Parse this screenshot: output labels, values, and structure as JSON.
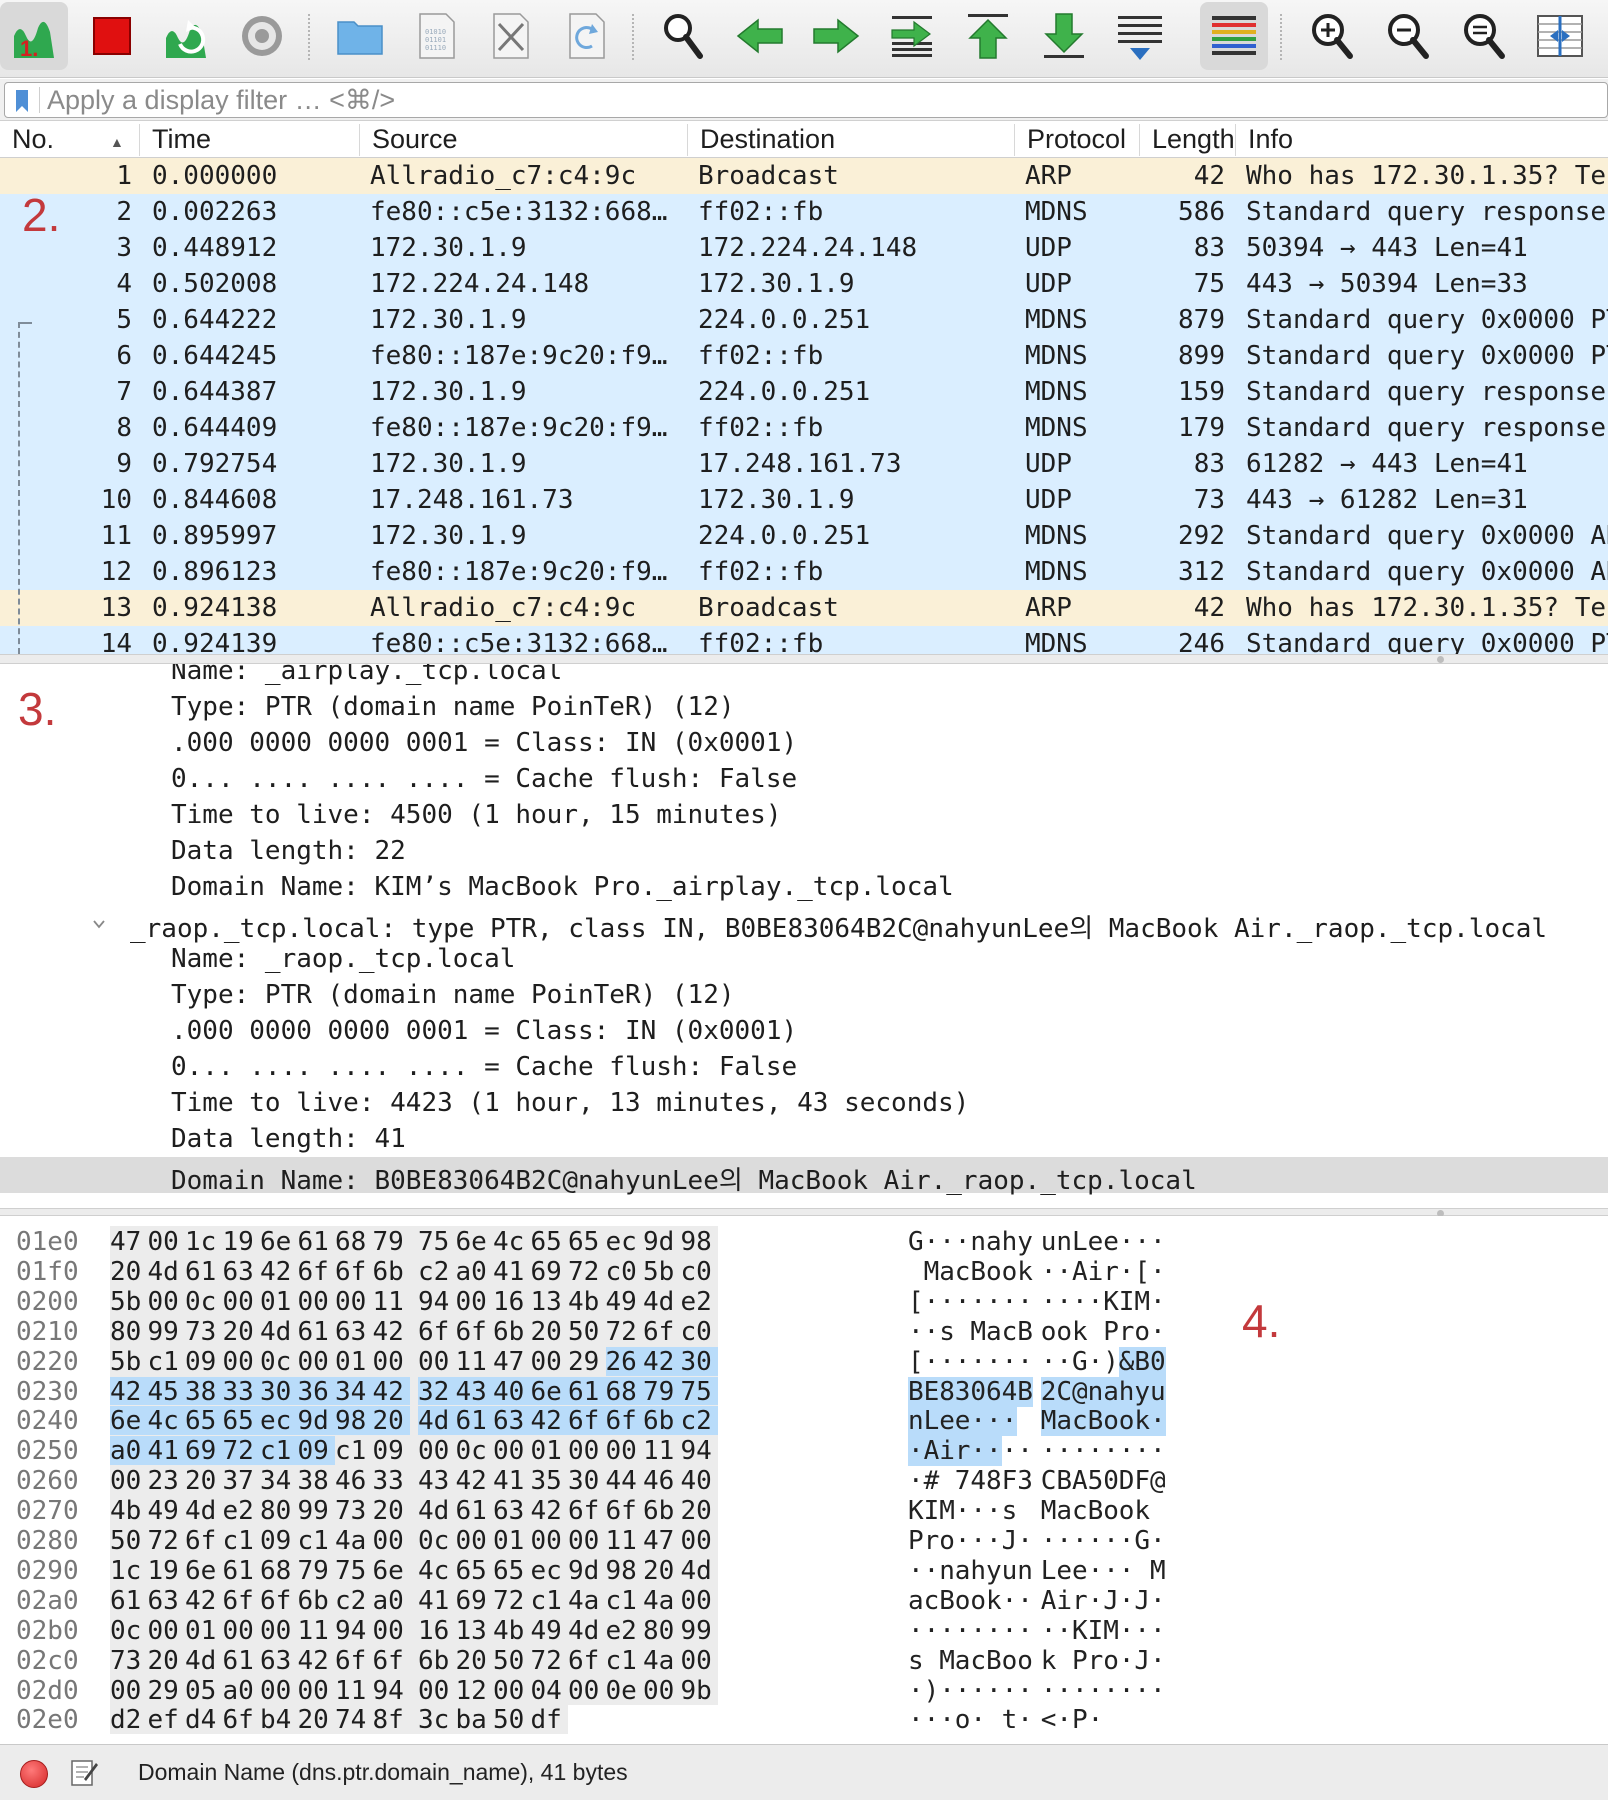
{
  "filter": {
    "placeholder": "Apply a display filter … <⌘/>"
  },
  "columns": [
    "No.",
    "Time",
    "Source",
    "Destination",
    "Protocol",
    "Length",
    "Info"
  ],
  "packets": [
    {
      "no": "1",
      "time": "0.000000",
      "src": "Allradio_c7:c4:9c",
      "dst": "Broadcast",
      "proto": "ARP",
      "len": "42",
      "info": "Who has 172.30.1.35? Te",
      "kind": "arp"
    },
    {
      "no": "2",
      "time": "0.002263",
      "src": "fe80::c5e:3132:668…",
      "dst": "ff02::fb",
      "proto": "MDNS",
      "len": "586",
      "info": "Standard query response",
      "kind": "udp"
    },
    {
      "no": "3",
      "time": "0.448912",
      "src": "172.30.1.9",
      "dst": "172.224.24.148",
      "proto": "UDP",
      "len": "83",
      "info": "50394 → 443 Len=41",
      "kind": "udp"
    },
    {
      "no": "4",
      "time": "0.502008",
      "src": "172.224.24.148",
      "dst": "172.30.1.9",
      "proto": "UDP",
      "len": "75",
      "info": "443 → 50394 Len=33",
      "kind": "udp"
    },
    {
      "no": "5",
      "time": "0.644222",
      "src": "172.30.1.9",
      "dst": "224.0.0.251",
      "proto": "MDNS",
      "len": "879",
      "info": "Standard query 0x0000 PT",
      "kind": "udp"
    },
    {
      "no": "6",
      "time": "0.644245",
      "src": "fe80::187e:9c20:f9…",
      "dst": "ff02::fb",
      "proto": "MDNS",
      "len": "899",
      "info": "Standard query 0x0000 PT",
      "kind": "udp"
    },
    {
      "no": "7",
      "time": "0.644387",
      "src": "172.30.1.9",
      "dst": "224.0.0.251",
      "proto": "MDNS",
      "len": "159",
      "info": "Standard query response",
      "kind": "udp"
    },
    {
      "no": "8",
      "time": "0.644409",
      "src": "fe80::187e:9c20:f9…",
      "dst": "ff02::fb",
      "proto": "MDNS",
      "len": "179",
      "info": "Standard query response",
      "kind": "udp"
    },
    {
      "no": "9",
      "time": "0.792754",
      "src": "172.30.1.9",
      "dst": "17.248.161.73",
      "proto": "UDP",
      "len": "83",
      "info": "61282 → 443 Len=41",
      "kind": "udp"
    },
    {
      "no": "10",
      "time": "0.844608",
      "src": "17.248.161.73",
      "dst": "172.30.1.9",
      "proto": "UDP",
      "len": "73",
      "info": "443 → 61282 Len=31",
      "kind": "udp"
    },
    {
      "no": "11",
      "time": "0.895997",
      "src": "172.30.1.9",
      "dst": "224.0.0.251",
      "proto": "MDNS",
      "len": "292",
      "info": "Standard query 0x0000 AN",
      "kind": "udp"
    },
    {
      "no": "12",
      "time": "0.896123",
      "src": "fe80::187e:9c20:f9…",
      "dst": "ff02::fb",
      "proto": "MDNS",
      "len": "312",
      "info": "Standard query 0x0000 AN",
      "kind": "udp"
    },
    {
      "no": "13",
      "time": "0.924138",
      "src": "Allradio_c7:c4:9c",
      "dst": "Broadcast",
      "proto": "ARP",
      "len": "42",
      "info": "Who has 172.30.1.35? Te",
      "kind": "arp"
    },
    {
      "no": "14",
      "time": "0.924139",
      "src": "fe80::c5e:3132:668…",
      "dst": "ff02::fb",
      "proto": "MDNS",
      "len": "246",
      "info": "Standard query 0x0000 PT",
      "kind": "udp"
    }
  ],
  "annotations": {
    "a2": "2.",
    "a3": "3.",
    "a4": "4."
  },
  "details": [
    {
      "text": "Name: _airplay._tcp.local",
      "indent": 2
    },
    {
      "text": "Type: PTR (domain name PoinTeR) (12)",
      "indent": 2
    },
    {
      "text": ".000 0000 0000 0001 = Class: IN (0x0001)",
      "indent": 2
    },
    {
      "text": "0... .... .... .... = Cache flush: False",
      "indent": 2
    },
    {
      "text": "Time to live: 4500 (1 hour, 15 minutes)",
      "indent": 2
    },
    {
      "text": "Data length: 22",
      "indent": 2
    },
    {
      "text": "Domain Name: KIM’s MacBook Pro._airplay._tcp.local",
      "indent": 2
    },
    {
      "text": "_raop._tcp.local: type PTR, class IN, B0BE83064B2C@nahyunLee의 MacBook Air._raop._tcp.local",
      "indent": 1,
      "expanded": true
    },
    {
      "text": "Name: _raop._tcp.local",
      "indent": 2
    },
    {
      "text": "Type: PTR (domain name PoinTeR) (12)",
      "indent": 2
    },
    {
      "text": ".000 0000 0000 0001 = Class: IN (0x0001)",
      "indent": 2
    },
    {
      "text": "0... .... .... .... = Cache flush: False",
      "indent": 2
    },
    {
      "text": "Time to live: 4423 (1 hour, 13 minutes, 43 seconds)",
      "indent": 2
    },
    {
      "text": "Data length: 41",
      "indent": 2
    },
    {
      "text": "Domain Name: B0BE83064B2C@nahyunLee의 MacBook Air._raop._tcp.local",
      "indent": 2,
      "selected": true
    }
  ],
  "hex": [
    {
      "off": "01e0",
      "bytes": "47 00 1c 19 6e 61 68 79 75 6e 4c 65 65 ec 9d 98",
      "ascii": "G···nahyunLee···",
      "hl": []
    },
    {
      "off": "01f0",
      "bytes": "20 4d 61 63 42 6f 6f 6b c2 a0 41 69 72 c0 5b c0",
      "ascii": " MacBook··Air·[·",
      "hl": []
    },
    {
      "off": "0200",
      "bytes": "5b 00 0c 00 01 00 00 11 94 00 16 13 4b 49 4d e2",
      "ascii": "[···········KIM·",
      "hl": []
    },
    {
      "off": "0210",
      "bytes": "80 99 73 20 4d 61 63 42 6f 6f 6b 20 50 72 6f c0",
      "ascii": "··s MacBook Pro·",
      "hl": []
    },
    {
      "off": "0220",
      "bytes": "5b c1 09 00 0c 00 01 00 00 11 47 00 29 26 42 30",
      "ascii": "[·········G·)&B0",
      "hl": [
        13,
        15
      ]
    },
    {
      "off": "0230",
      "bytes": "42 45 38 33 30 36 34 42 32 43 40 6e 61 68 79 75",
      "ascii": "BE83064B2C@nahyu",
      "hl": [
        0,
        15
      ]
    },
    {
      "off": "0240",
      "bytes": "6e 4c 65 65 ec 9d 98 20 4d 61 63 42 6f 6f 6b c2",
      "ascii": "nLee··· MacBook·",
      "hl": [
        0,
        15
      ]
    },
    {
      "off": "0250",
      "bytes": "a0 41 69 72 c1 09 c1 09 00 0c 00 01 00 00 11 94",
      "ascii": "·Air············",
      "hl": [
        0,
        5
      ]
    },
    {
      "off": "0260",
      "bytes": "00 23 20 37 34 38 46 33 43 42 41 35 30 44 46 40",
      "ascii": "·# 748F3CBA50DF@",
      "hl": []
    },
    {
      "off": "0270",
      "bytes": "4b 49 4d e2 80 99 73 20 4d 61 63 42 6f 6f 6b 20",
      "ascii": "KIM···s MacBook ",
      "hl": []
    },
    {
      "off": "0280",
      "bytes": "50 72 6f c1 09 c1 4a 00 0c 00 01 00 00 11 47 00",
      "ascii": "Pro···J·······G·",
      "hl": []
    },
    {
      "off": "0290",
      "bytes": "1c 19 6e 61 68 79 75 6e 4c 65 65 ec 9d 98 20 4d",
      "ascii": "··nahyunLee··· M",
      "hl": []
    },
    {
      "off": "02a0",
      "bytes": "61 63 42 6f 6f 6b c2 a0 41 69 72 c1 4a c1 4a 00",
      "ascii": "acBook··Air·J·J·",
      "hl": []
    },
    {
      "off": "02b0",
      "bytes": "0c 00 01 00 00 11 94 00 16 13 4b 49 4d e2 80 99",
      "ascii": "··········KIM···",
      "hl": []
    },
    {
      "off": "02c0",
      "bytes": "73 20 4d 61 63 42 6f 6f 6b 20 50 72 6f c1 4a 00",
      "ascii": "s MacBook Pro·J·",
      "hl": []
    },
    {
      "off": "02d0",
      "bytes": "00 29 05 a0 00 00 11 94 00 12 00 04 00 0e 00 9b",
      "ascii": "·)··············",
      "hl": []
    },
    {
      "off": "02e0",
      "bytes": "d2 ef d4 6f b4 20 74 8f 3c ba 50 df",
      "ascii": "···o· t·<·P·",
      "hl": []
    }
  ],
  "status": {
    "text": "Domain Name (dns.ptr.domain_name), 41 bytes"
  },
  "icons": [
    "start-capture-icon",
    "stop-capture-icon",
    "restart-capture-icon",
    "capture-options-icon",
    "open-file-icon",
    "save-file-icon",
    "close-file-icon",
    "reload-file-icon",
    "find-packet-icon",
    "go-back-icon",
    "go-forward-icon",
    "go-to-packet-icon",
    "go-first-icon",
    "go-last-icon",
    "auto-scroll-icon",
    "colorize-icon",
    "zoom-in-icon",
    "zoom-out-icon",
    "normal-size-icon",
    "resize-columns-icon"
  ],
  "colors": {
    "arp_row": "#faf0d7",
    "udp_row": "#daeeff",
    "selection": "#b9dcfa",
    "annotation": "#c3393c"
  }
}
